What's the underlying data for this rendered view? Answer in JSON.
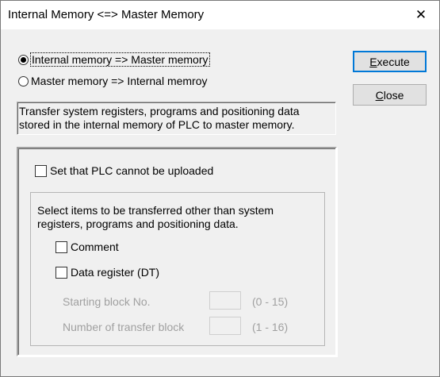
{
  "window": {
    "title": "Internal Memory <=> Master Memory",
    "close_glyph": "✕"
  },
  "direction": {
    "options": [
      {
        "label": "Internal memory => Master memory",
        "selected": true
      },
      {
        "label": "Master memory => Internal memroy",
        "selected": false
      }
    ]
  },
  "buttons": {
    "execute": {
      "prefix": "",
      "accel": "E",
      "rest": "xecute"
    },
    "close": {
      "prefix": "",
      "accel": "C",
      "rest": "lose"
    }
  },
  "description": "Transfer system registers, programs and positioning data stored in the internal memory of PLC to master memory.",
  "upload_protect": {
    "label": "Set that PLC cannot be uploaded",
    "checked": false
  },
  "items": {
    "note": "Select items to be transferred other than system registers, programs and positioning data.",
    "comment": {
      "label": "Comment",
      "checked": false
    },
    "data_register": {
      "label": "Data register (DT)",
      "checked": false
    },
    "starting_block": {
      "label": "Starting block No.",
      "value": "",
      "range": "(0 - 15)"
    },
    "transfer_blocks": {
      "label": "Number of transfer block",
      "value": "",
      "range": "(1 - 16)"
    }
  },
  "colors": {
    "accent": "#0078d7",
    "dialog_bg": "#f0f0f0",
    "disabled_text": "#a0a0a0"
  }
}
